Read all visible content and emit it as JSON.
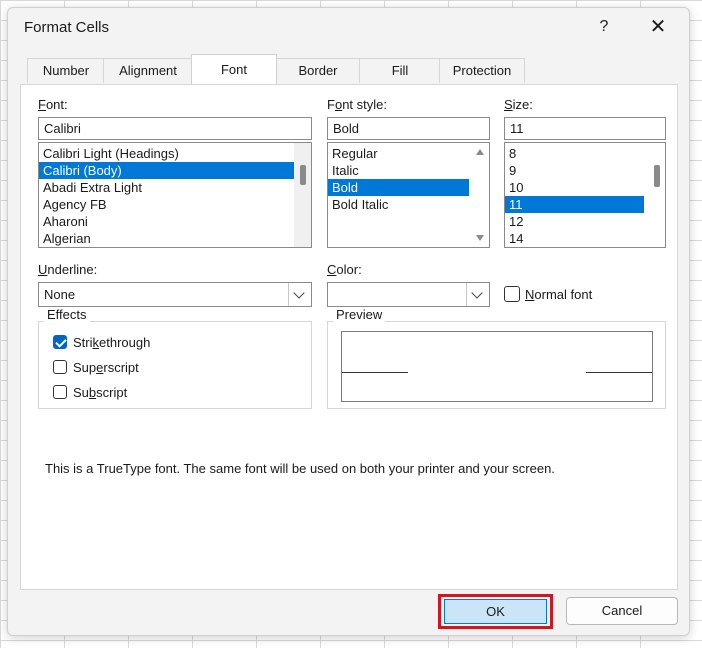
{
  "dialog": {
    "title": "Format Cells",
    "help_label": "?",
    "close_label": "✕"
  },
  "tabs": [
    {
      "label": "Number"
    },
    {
      "label": "Alignment"
    },
    {
      "label": "Font",
      "active": true
    },
    {
      "label": "Border"
    },
    {
      "label": "Fill"
    },
    {
      "label": "Protection"
    }
  ],
  "font": {
    "label_key": "F",
    "label_rest": "ont:",
    "value": "Calibri",
    "items": [
      "Calibri Light (Headings)",
      "Calibri (Body)",
      "Abadi Extra Light",
      "Agency FB",
      "Aharoni",
      "Algerian"
    ],
    "selected": "Calibri (Body)"
  },
  "font_style": {
    "label_pre": "F",
    "label_key": "o",
    "label_rest": "nt style:",
    "value": "Bold",
    "items": [
      "Regular",
      "Italic",
      "Bold",
      "Bold Italic"
    ],
    "selected": "Bold"
  },
  "size": {
    "label_key": "S",
    "label_rest": "ize:",
    "value": "11",
    "items": [
      "8",
      "9",
      "10",
      "11",
      "12",
      "14"
    ],
    "selected": "11"
  },
  "underline": {
    "label_key": "U",
    "label_rest": "nderline:",
    "value": "None"
  },
  "color": {
    "label_key": "C",
    "label_rest": "olor:",
    "value": ""
  },
  "normal_font": {
    "label_key": "N",
    "label_rest": "ormal font",
    "checked": false
  },
  "effects": {
    "title": "Effects",
    "strikethrough": {
      "pre": "Stri",
      "key": "k",
      "rest": "ethrough",
      "checked": true
    },
    "superscript": {
      "pre": "Sup",
      "key": "e",
      "rest": "rscript",
      "checked": false
    },
    "subscript": {
      "pre": "Su",
      "key": "b",
      "rest": "script",
      "checked": false
    }
  },
  "preview": {
    "title": "Preview"
  },
  "info_text": "This is a TrueType font.  The same font will be used on both your printer and your screen.",
  "buttons": {
    "ok": "OK",
    "cancel": "Cancel"
  },
  "colors": {
    "selection": "#0078d7",
    "ok_highlight": "#d4151f",
    "checkbox_checked": "#0067c0"
  }
}
